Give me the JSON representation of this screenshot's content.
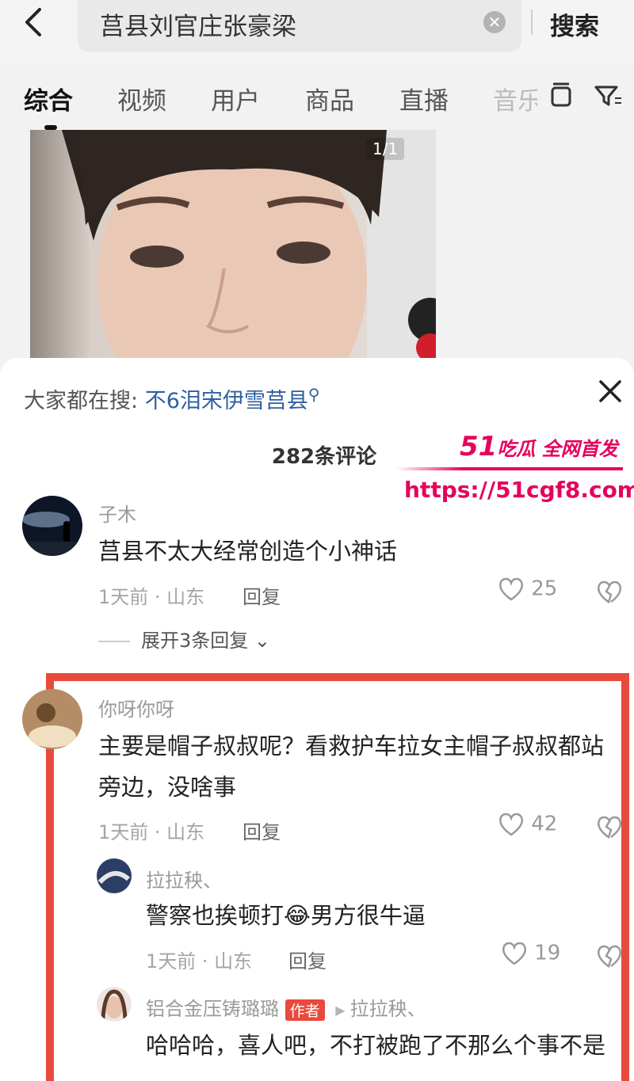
{
  "search": {
    "query": "莒县刘官庄张豪梁",
    "button_label": "搜索"
  },
  "tabs": [
    "综合",
    "视频",
    "用户",
    "商品",
    "直播",
    "音乐"
  ],
  "image_badge": "1/1",
  "sheet": {
    "hot_search_prefix": "大家都在搜:",
    "hot_search_term": "不6泪宋伊雪莒县",
    "comment_count": "282条评论"
  },
  "watermark": {
    "brand_51": "51",
    "brand_text": "吃瓜 全网首发",
    "url": "https://51cgf8.com"
  },
  "comments": [
    {
      "user": "子木",
      "text": "莒县不太大经常创造个小神话",
      "meta": "1天前 · 山东",
      "reply": "回复",
      "likes": "25",
      "expand": "展开3条回复"
    },
    {
      "user": "你呀你呀",
      "text": "主要是帽子叔叔呢？看救护车拉女主帽子叔叔都站旁边，没啥事",
      "meta": "1天前 · 山东",
      "reply": "回复",
      "likes": "42"
    }
  ],
  "replies": [
    {
      "user": "拉拉秧、",
      "text_before_emoji": "警察也挨顿打",
      "emoji": "😂",
      "text_after_emoji": "男方很牛逼",
      "meta": "1天前 · 山东",
      "reply": "回复",
      "likes": "19"
    },
    {
      "user": "铝合金压铸璐璐",
      "author_tag": "作者",
      "reply_to": "拉拉秧、",
      "text": "哈哈哈，喜人吧，不打被跑了不那么个事不是"
    }
  ],
  "colors": {
    "highlight_box": "#e84a3c",
    "link_blue": "#2e5fa0",
    "watermark_pink": "#e6005c"
  }
}
